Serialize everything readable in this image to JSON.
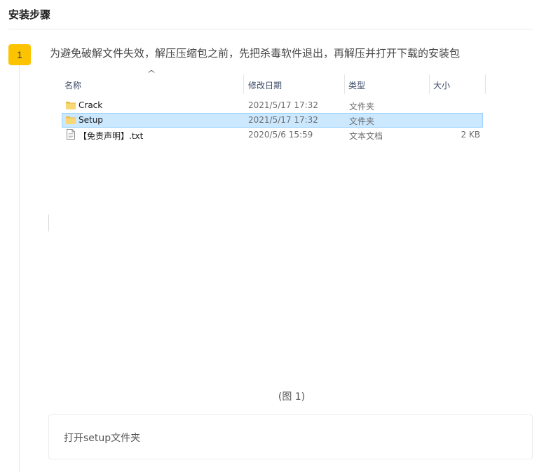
{
  "section": {
    "title": "安装步骤"
  },
  "step": {
    "number": "1",
    "text": "为避免破解文件失效，解压压缩包之前，先把杀毒软件退出，再解压并打开下载的安装包"
  },
  "explorer": {
    "columns": {
      "name": "名称",
      "date": "修改日期",
      "type": "类型",
      "size": "大小"
    },
    "sort_indicator": "^",
    "rows": [
      {
        "icon": "folder-icon",
        "name": "Crack",
        "date": "2021/5/17 17:32",
        "type": "文件夹",
        "size": "",
        "selected": false
      },
      {
        "icon": "folder-icon",
        "name": "Setup",
        "date": "2021/5/17 17:32",
        "type": "文件夹",
        "size": "",
        "selected": true
      },
      {
        "icon": "text-file-icon",
        "name": "【免责声明】.txt",
        "date": "2020/5/6 15:59",
        "type": "文本文档",
        "size": "2 KB",
        "selected": false
      }
    ]
  },
  "caption": "(图 1)",
  "note": "打开setup文件夹",
  "colors": {
    "badge": "#fcc400",
    "selection_bg": "#cce8ff",
    "selection_border": "#99d1ff",
    "folder": "#f8d775"
  }
}
